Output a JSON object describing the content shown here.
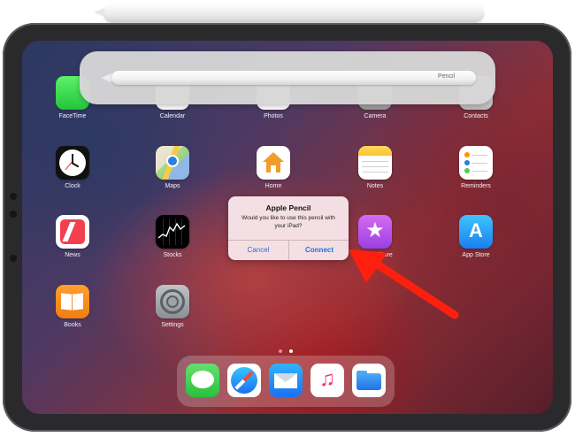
{
  "apps": {
    "row1": {
      "facetime": "FaceTime",
      "calendar": "Calendar",
      "photos": "Photos",
      "camera": "Camera",
      "contacts": "Contacts"
    },
    "row2": {
      "clock": "Clock",
      "maps": "Maps",
      "home": "Home",
      "notes": "Notes",
      "reminders": "Reminders"
    },
    "row3": {
      "news": "News",
      "stocks": "Stocks",
      "itunes": "iTunes Store",
      "appstore": "App Store"
    },
    "row4": {
      "books": "Books",
      "settings": "Settings"
    }
  },
  "pencil_banner": {
    "brand": "Pencil"
  },
  "dialog": {
    "title": "Apple Pencil",
    "message": "Would you like to use this pencil with your iPad?",
    "cancel": "Cancel",
    "connect": "Connect"
  },
  "dock": [
    "messages-icon",
    "safari-icon",
    "mail-icon",
    "music-icon",
    "files-icon"
  ],
  "page_dots": {
    "count": 2,
    "active_index": 1
  },
  "colors": {
    "alert_button": "#1f6fe0",
    "annotation_arrow": "#ff1f0e"
  }
}
